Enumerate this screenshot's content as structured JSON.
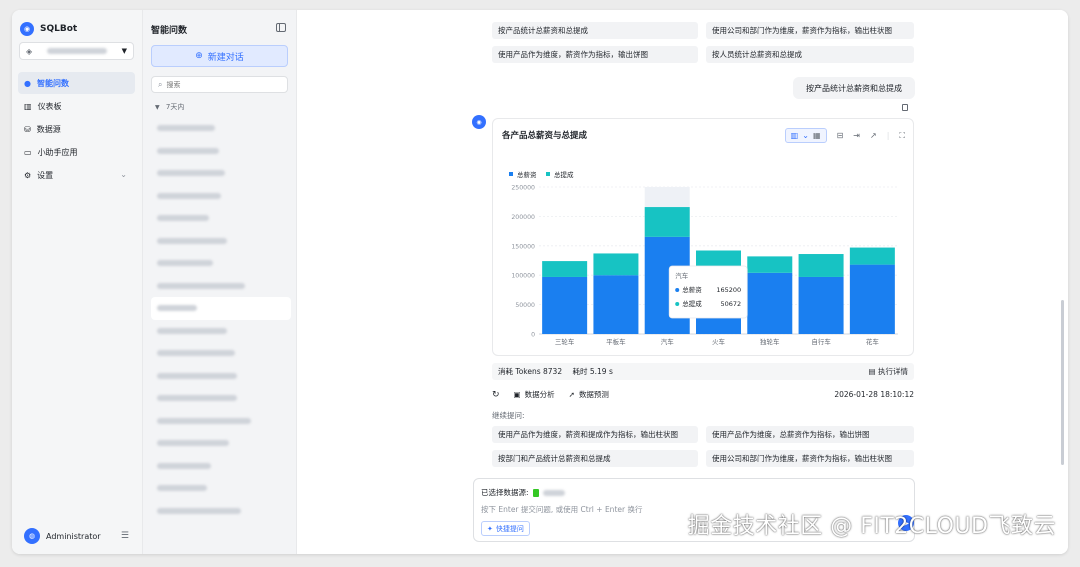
{
  "app": {
    "brand": "SQLBot",
    "datasource_select": "",
    "nav": [
      {
        "label": "智能问数",
        "icon": "chat-icon",
        "active": true
      },
      {
        "label": "仪表板",
        "icon": "dashboard-icon",
        "active": false
      },
      {
        "label": "数据源",
        "icon": "database-icon",
        "active": false
      },
      {
        "label": "小助手应用",
        "icon": "assistant-app-icon",
        "active": false
      },
      {
        "label": "设置",
        "icon": "gear-icon",
        "active": false
      }
    ],
    "user": "Administrator"
  },
  "history": {
    "title": "智能问数",
    "new_chat": "新建对话",
    "search_placeholder": "搜索",
    "group_label": "7天内",
    "item_count": 18,
    "active_index": 8
  },
  "conversation": {
    "prev_suggestions": [
      "按产品统计总薪资和总提成",
      "使用公司和部门作为维度，薪资作为指标，输出柱状图",
      "使用产品作为维度，薪资作为指标，输出饼图",
      "按人员统计总薪资和总提成"
    ],
    "user_message": "按产品统计总薪资和总提成",
    "meta": {
      "tokens": "消耗 Tokens 8732",
      "time": "耗时 5.19 s",
      "detail": "执行详情"
    },
    "actions": {
      "analysis": "数据分析",
      "predict": "数据预测",
      "timestamp": "2026-01-28 18:10:12"
    },
    "follow_label": "继续提问:",
    "follow_suggestions": [
      "使用产品作为维度，薪资和提成作为指标，输出柱状图",
      "使用产品作为维度，总薪资作为指标，输出饼图",
      "按部门和产品统计总薪资和总提成",
      "使用公司和部门作为维度，薪资作为指标，输出柱状图"
    ]
  },
  "composer": {
    "selected_ds_label": "已选择数据源:",
    "placeholder": "按下 Enter 提交问题, 或使用 Ctrl + Enter 换行",
    "quick_button": "快捷提问"
  },
  "colors": {
    "accent": "#3370ff",
    "salary": "#1a7ff0",
    "commission": "#17c3c3"
  },
  "chart_data": {
    "type": "bar",
    "stacked": true,
    "title": "各产品总薪资与总提成",
    "categories": [
      "三轮车",
      "平板车",
      "汽车",
      "火车",
      "独轮车",
      "自行车",
      "花车"
    ],
    "series": [
      {
        "name": "总薪资",
        "values": [
          97000,
          100000,
          165200,
          112000,
          104000,
          97000,
          118000
        ]
      },
      {
        "name": "总提成",
        "values": [
          27000,
          37000,
          50672,
          30000,
          28000,
          39000,
          29000
        ]
      }
    ],
    "y_ticks": [
      "0",
      "50000",
      "100000",
      "150000",
      "200000",
      "250000"
    ],
    "ylim": [
      0,
      250000
    ],
    "legend_position": "top-left",
    "tooltip": {
      "category": "汽车",
      "rows": [
        {
          "name": "总薪资",
          "value": "165200"
        },
        {
          "name": "总提成",
          "value": "50672"
        }
      ]
    }
  }
}
